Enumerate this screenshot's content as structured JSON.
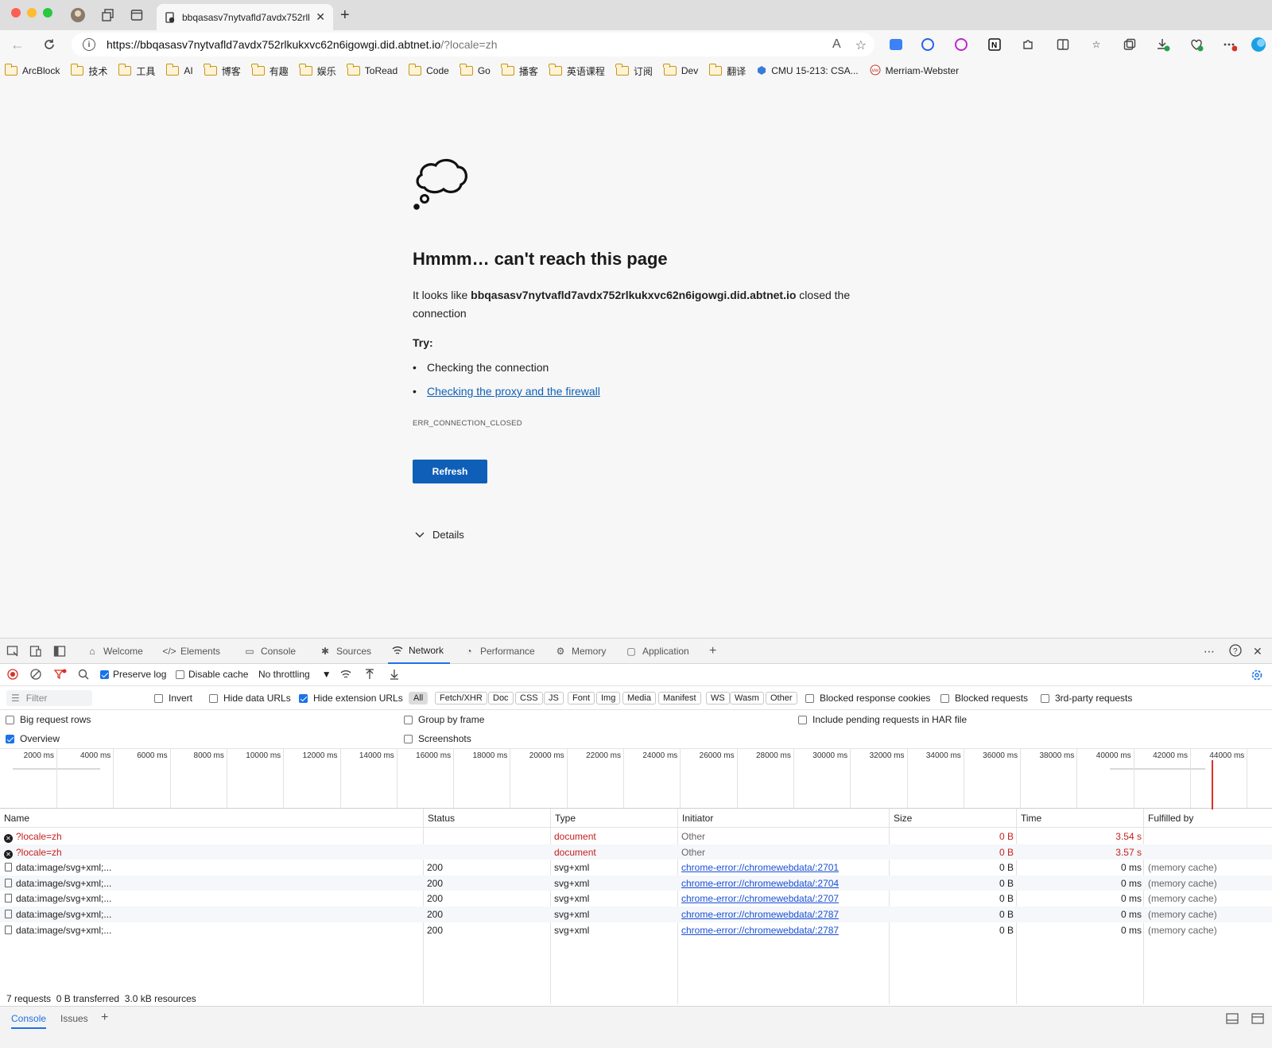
{
  "browser": {
    "tab_title": "bbqasasv7nytvafld7avdx752rlk",
    "url_host": "https://bbqasasv7nytvafld7avdx752rlkukxvc62n6igowgi.did.abtnet.io",
    "url_path": "/?locale=zh",
    "read_aloud_label": "A",
    "bookmarks": [
      "ArcBlock",
      "技术",
      "工具",
      "AI",
      "博客",
      "有趣",
      "娱乐",
      "ToRead",
      "Code",
      "Go",
      "播客",
      "英语课程",
      "订阅",
      "Dev",
      "翻译",
      "CMU 15-213: CSA...",
      "Merriam-Webster"
    ]
  },
  "error_page": {
    "title": "Hmmm… can't reach this page",
    "body_prefix": "It looks like ",
    "host": "bbqasasv7nytvafld7avdx752rlkukxvc62n6igowgi.did.abtnet.io",
    "body_suffix": " closed the connection",
    "try_label": "Try:",
    "suggestion_1": "Checking the connection",
    "suggestion_2": "Checking the proxy and the firewall",
    "error_code": "ERR_CONNECTION_CLOSED",
    "refresh_label": "Refresh",
    "details_label": "Details"
  },
  "devtools": {
    "tabs": [
      "Welcome",
      "Elements",
      "Console",
      "Sources",
      "Network",
      "Performance",
      "Memory",
      "Application"
    ],
    "active_tab": "Network",
    "toolbar": {
      "preserve_log": "Preserve log",
      "disable_cache": "Disable cache",
      "throttling": "No throttling"
    },
    "filter": {
      "placeholder": "Filter",
      "invert": "Invert",
      "hide_data_urls": "Hide data URLs",
      "hide_extension_urls": "Hide extension URLs",
      "chips": [
        "All",
        "Fetch/XHR",
        "Doc",
        "CSS",
        "JS",
        "Font",
        "Img",
        "Media",
        "Manifest",
        "WS",
        "Wasm",
        "Other"
      ],
      "blocked_cookies": "Blocked response cookies",
      "blocked_requests": "Blocked requests",
      "third_party": "3rd-party requests"
    },
    "options": {
      "big_rows": "Big request rows",
      "group_by_frame": "Group by frame",
      "include_pending": "Include pending requests in HAR file",
      "overview": "Overview",
      "screenshots": "Screenshots"
    },
    "timeline_ticks": [
      "2000 ms",
      "4000 ms",
      "6000 ms",
      "8000 ms",
      "10000 ms",
      "12000 ms",
      "14000 ms",
      "16000 ms",
      "18000 ms",
      "20000 ms",
      "22000 ms",
      "24000 ms",
      "26000 ms",
      "28000 ms",
      "30000 ms",
      "32000 ms",
      "34000 ms",
      "36000 ms",
      "38000 ms",
      "40000 ms",
      "42000 ms",
      "44000 ms"
    ],
    "columns": [
      "Name",
      "Status",
      "Type",
      "Initiator",
      "Size",
      "Time",
      "Fulfilled by"
    ],
    "rows": [
      {
        "name": "?locale=zh",
        "status": "",
        "type": "document",
        "initiator": "Other",
        "size": "0 B",
        "time": "3.54 s",
        "fulfilled": "",
        "error": true
      },
      {
        "name": "?locale=zh",
        "status": "",
        "type": "document",
        "initiator": "Other",
        "size": "0 B",
        "time": "3.57 s",
        "fulfilled": "",
        "error": true
      },
      {
        "name": "data:image/svg+xml;...",
        "status": "200",
        "type": "svg+xml",
        "initiator": "chrome-error://chromewebdata/:2701",
        "size": "0 B",
        "time": "0 ms",
        "fulfilled": "(memory cache)",
        "error": false
      },
      {
        "name": "data:image/svg+xml;...",
        "status": "200",
        "type": "svg+xml",
        "initiator": "chrome-error://chromewebdata/:2704",
        "size": "0 B",
        "time": "0 ms",
        "fulfilled": "(memory cache)",
        "error": false
      },
      {
        "name": "data:image/svg+xml;...",
        "status": "200",
        "type": "svg+xml",
        "initiator": "chrome-error://chromewebdata/:2707",
        "size": "0 B",
        "time": "0 ms",
        "fulfilled": "(memory cache)",
        "error": false
      },
      {
        "name": "data:image/svg+xml;...",
        "status": "200",
        "type": "svg+xml",
        "initiator": "chrome-error://chromewebdata/:2787",
        "size": "0 B",
        "time": "0 ms",
        "fulfilled": "(memory cache)",
        "error": false
      },
      {
        "name": "data:image/svg+xml;...",
        "status": "200",
        "type": "svg+xml",
        "initiator": "chrome-error://chromewebdata/:2787",
        "size": "0 B",
        "time": "0 ms",
        "fulfilled": "(memory cache)",
        "error": false
      }
    ],
    "summary": "7 requests  0 B transferred  3.0 kB resources",
    "drawer_tabs": [
      "Console",
      "Issues"
    ]
  },
  "colors": {
    "accent": "#0f5fb8",
    "devtools_accent": "#1a73e8",
    "error_red": "#c5221f"
  }
}
